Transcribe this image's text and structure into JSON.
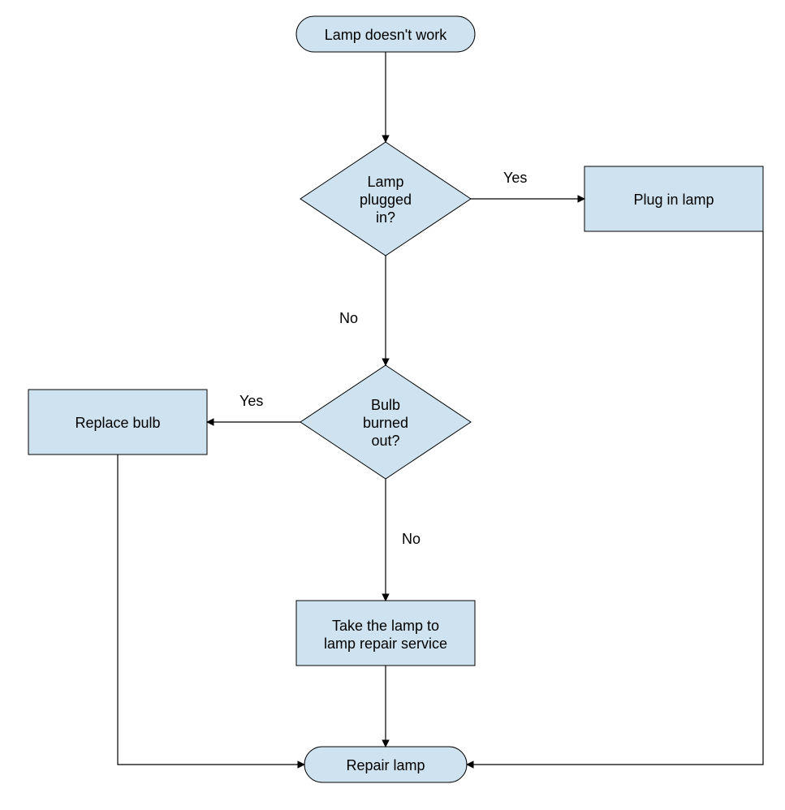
{
  "chart_data": {
    "type": "flowchart",
    "nodes": [
      {
        "id": "start",
        "shape": "terminator",
        "label": "Lamp doesn't work"
      },
      {
        "id": "plugged",
        "shape": "decision",
        "label": "Lamp\nplugged\nin?"
      },
      {
        "id": "plugin",
        "shape": "process",
        "label": "Plug in lamp"
      },
      {
        "id": "bulb",
        "shape": "decision",
        "label": "Bulb\nburned\nout?"
      },
      {
        "id": "replace",
        "shape": "process",
        "label": "Replace bulb"
      },
      {
        "id": "service",
        "shape": "process",
        "label": "Take the lamp to\nlamp repair service"
      },
      {
        "id": "end",
        "shape": "terminator",
        "label": "Repair lamp"
      }
    ],
    "edges": [
      {
        "from": "start",
        "to": "plugged",
        "label": ""
      },
      {
        "from": "plugged",
        "to": "plugin",
        "label": "Yes"
      },
      {
        "from": "plugged",
        "to": "bulb",
        "label": "No"
      },
      {
        "from": "bulb",
        "to": "replace",
        "label": "Yes"
      },
      {
        "from": "bulb",
        "to": "service",
        "label": "No"
      },
      {
        "from": "service",
        "to": "end",
        "label": ""
      },
      {
        "from": "replace",
        "to": "end",
        "label": ""
      },
      {
        "from": "plugin",
        "to": "end",
        "label": ""
      }
    ]
  },
  "labels": {
    "start": "Lamp doesn't work",
    "plugged_l1": "Lamp",
    "plugged_l2": "plugged",
    "plugged_l3": "in?",
    "plugin": "Plug in lamp",
    "bulb_l1": "Bulb",
    "bulb_l2": "burned",
    "bulb_l3": "out?",
    "replace": "Replace bulb",
    "service_l1": "Take the lamp to",
    "service_l2": "lamp repair service",
    "end": "Repair lamp",
    "yes": "Yes",
    "no": "No"
  }
}
